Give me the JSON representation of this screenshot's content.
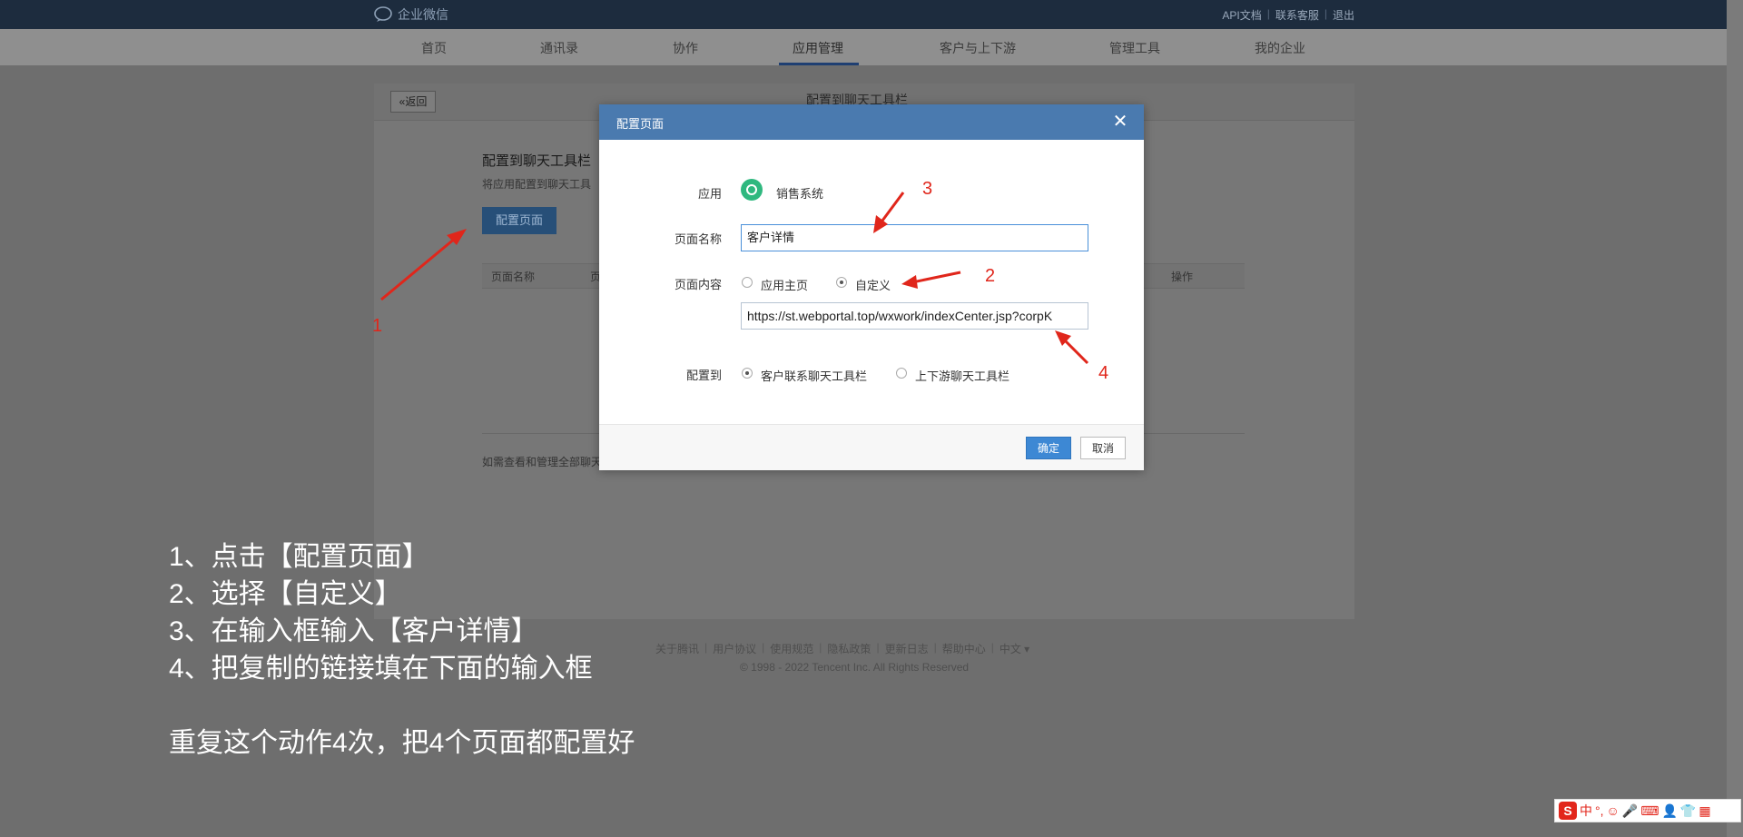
{
  "header": {
    "logo_text": "企业微信",
    "links": [
      "API文档",
      "联系客服",
      "退出"
    ]
  },
  "nav": {
    "items": [
      "首页",
      "通讯录",
      "协作",
      "应用管理",
      "客户与上下游",
      "管理工具",
      "我的企业"
    ],
    "active": "应用管理"
  },
  "page": {
    "back_label": "返回",
    "title": "配置到聊天工具栏",
    "section_title": "配置到聊天工具栏",
    "section_desc": "将应用配置到聊天工具",
    "config_button": "配置页面",
    "table_headers": [
      "页面名称",
      "页",
      "操作"
    ],
    "footnote": "如需查看和管理全部聊天"
  },
  "footer": {
    "links": [
      "关于腾讯",
      "用户协议",
      "使用规范",
      "隐私政策",
      "更新日志",
      "帮助中心",
      "中文 ▾"
    ],
    "copyright": "© 1998 - 2022 Tencent Inc. All Rights Reserved"
  },
  "modal": {
    "title": "配置页面",
    "close_glyph": "✕",
    "app_label": "应用",
    "app_name": "销售系统",
    "page_name_label": "页面名称",
    "page_name_value": "客户详情",
    "content_label": "页面内容",
    "content_options": [
      "应用主页",
      "自定义"
    ],
    "content_selected": "自定义",
    "url_value": "https://st.webportal.top/wxwork/indexCenter.jsp?corpK",
    "target_label": "配置到",
    "target_options": [
      "客户联系聊天工具栏",
      "上下游聊天工具栏"
    ],
    "target_selected": "客户联系聊天工具栏",
    "ok_label": "确定",
    "cancel_label": "取消"
  },
  "annotations": {
    "numbers": [
      "1",
      "2",
      "3",
      "4"
    ],
    "arrow_color": "#e0261b",
    "instructions": [
      "1、点击【配置页面】",
      "2、选择【自定义】",
      "3、在输入框输入【客户详情】",
      "4、把复制的链接填在下面的输入框",
      "",
      "重复这个动作4次，把4个页面都配置好"
    ]
  },
  "ime": {
    "logo": "S",
    "mode": "中",
    "punct": "°,"
  }
}
